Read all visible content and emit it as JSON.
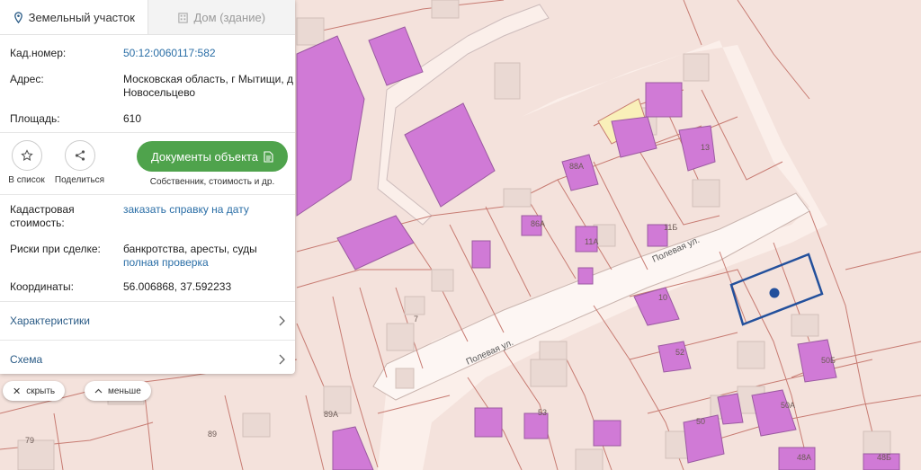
{
  "tabs": {
    "land": "Земельный участок",
    "house": "Дом (здание)"
  },
  "info": {
    "cad_label": "Кад.номер:",
    "cad_value": "50:12:0060117:582",
    "addr_label": "Адрес:",
    "addr_value": "Московская область, г Мытищи, д Новосельцево",
    "area_label": "Площадь:",
    "area_value": "610"
  },
  "actions": {
    "favorite": "В список",
    "share": "Поделиться",
    "docs_button": "Документы объекта",
    "docs_sub": "Собственник, стоимость и др."
  },
  "details": {
    "value_label": "Кадастровая стоимость:",
    "value_link": "заказать справку на дату",
    "risk_label": "Риски при сделке:",
    "risk_value": "банкротства, аресты, суды",
    "risk_link": "полная проверка",
    "coord_label": "Координаты:",
    "coord_value": "56.006868, 37.592233"
  },
  "sections": {
    "characteristics": "Характеристики",
    "scheme": "Схема"
  },
  "controls": {
    "hide": "скрыть",
    "less": "меньше"
  },
  "map": {
    "streets": [
      "Полевая ул.",
      "Полевая ул."
    ],
    "labels": [
      "88А",
      "13",
      "86А",
      "11А",
      "11Б",
      "10",
      "7",
      "52",
      "50Б",
      "50А",
      "53",
      "50",
      "48А",
      "48Б",
      "89А",
      "89",
      "79"
    ]
  },
  "colors": {
    "building": "#d07ad6",
    "parcel_border": "#c77b72",
    "selected_parcel": "#23509c",
    "docs_button": "#4fa34c",
    "link": "#2a6ea6"
  }
}
